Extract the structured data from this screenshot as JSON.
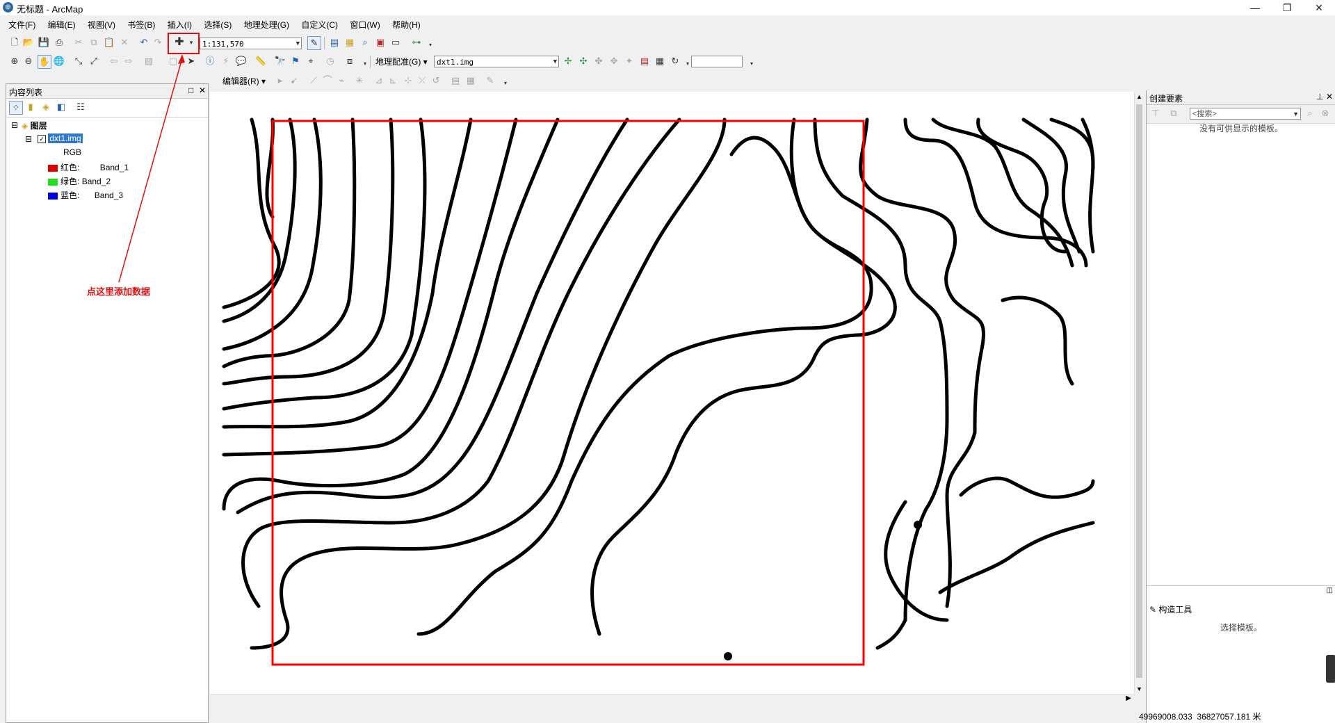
{
  "window": {
    "title": "无标题 - ArcMap",
    "minimize": "—",
    "restore": "❐",
    "close": "✕"
  },
  "menu": [
    "文件(F)",
    "编辑(E)",
    "视图(V)",
    "书签(B)",
    "插入(I)",
    "选择(S)",
    "地理处理(G)",
    "自定义(C)",
    "窗口(W)",
    "帮助(H)"
  ],
  "toolbar": {
    "scale_value": "1:131,570",
    "georef_label": "地理配准(G)",
    "georef_layer": "dxt1.img",
    "editor_label": "编辑器(R)"
  },
  "toc": {
    "title": "内容列表",
    "root": "图层",
    "layer": "dxt1.img",
    "rgb": "RGB",
    "bands": [
      {
        "label": "红色:",
        "band": "Band_1",
        "color": "#e00000"
      },
      {
        "label": "绿色:",
        "band": "Band_2",
        "color": "#1ee01e"
      },
      {
        "label": "蓝色:",
        "band": "Band_3",
        "color": "#0000e0"
      }
    ]
  },
  "annotation": {
    "text": "点这里添加数据",
    "color": "#e01010"
  },
  "create_features": {
    "title": "创建要素",
    "search_placeholder": "<搜索>",
    "empty_msg": "没有可供显示的模板。",
    "construct_title": "构造工具",
    "construct_msg": "选择模板。"
  },
  "status": {
    "coords": "49969008.033  36827057.181 米"
  },
  "colors": {
    "frame_red": "#ff0000",
    "contour": "#000000",
    "selection": "#3178c6"
  },
  "icons": [
    "new-document-icon",
    "open-folder-icon",
    "save-icon",
    "print-icon",
    "cut-icon",
    "copy-icon",
    "paste-icon",
    "delete-icon",
    "undo-icon",
    "redo-icon",
    "add-data-icon",
    "zoom-in-icon",
    "zoom-out-icon",
    "pan-icon",
    "full-extent-icon",
    "select-arrow-icon",
    "identify-icon",
    "find-icon"
  ]
}
